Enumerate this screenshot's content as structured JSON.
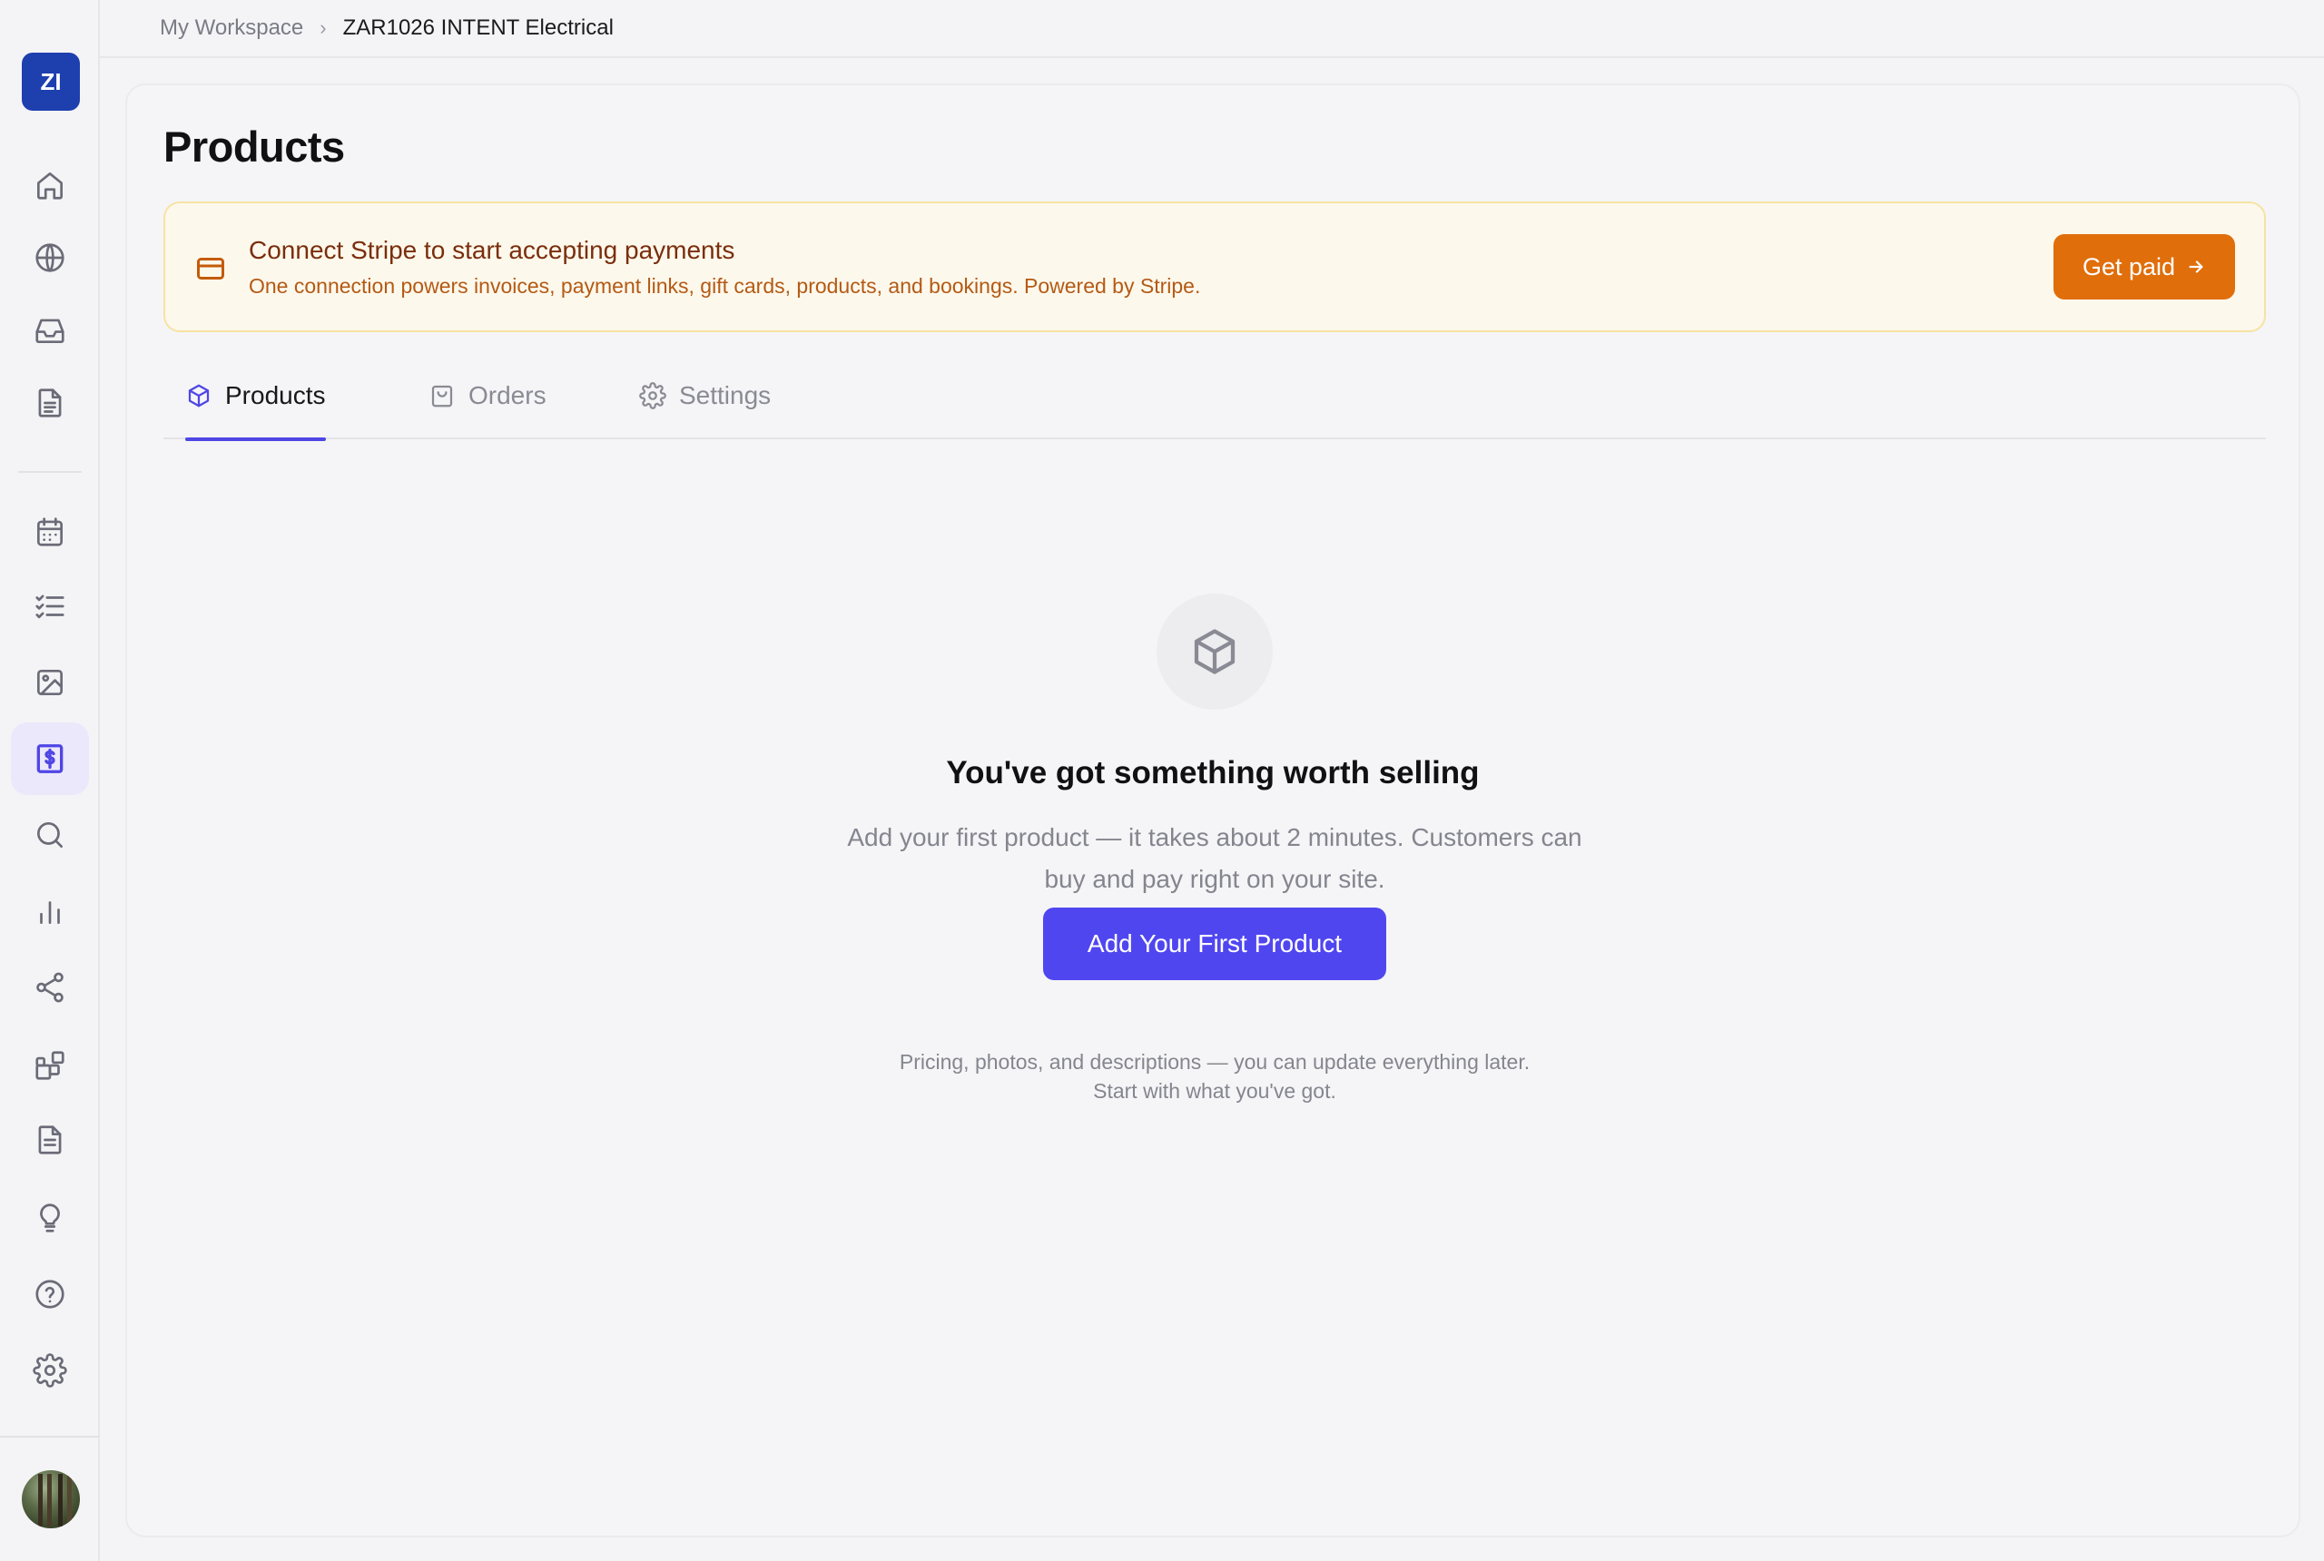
{
  "workspace": {
    "initials": "ZI"
  },
  "breadcrumb": {
    "items": [
      "My Workspace",
      "ZAR1026 INTENT Electrical"
    ],
    "separator": "›"
  },
  "sidebar": {
    "active": "payments",
    "items": [
      {
        "icon": "home-icon"
      },
      {
        "icon": "globe-icon"
      },
      {
        "icon": "inbox-icon"
      },
      {
        "icon": "document-icon"
      },
      {
        "icon": "calendar-icon"
      },
      {
        "icon": "checklist-icon"
      },
      {
        "icon": "image-icon"
      },
      {
        "icon": "receipt-dollar-icon"
      },
      {
        "icon": "search-icon"
      },
      {
        "icon": "bar-chart-icon"
      },
      {
        "icon": "share-icon"
      },
      {
        "icon": "widgets-icon"
      },
      {
        "icon": "file-text-icon"
      },
      {
        "icon": "lightbulb-icon"
      },
      {
        "icon": "help-circle-icon"
      },
      {
        "icon": "gear-icon"
      }
    ]
  },
  "page": {
    "title": "Products"
  },
  "banner": {
    "title": "Connect Stripe to start accepting payments",
    "subtitle": "One connection powers invoices, payment links, gift cards, products, and bookings. Powered by Stripe.",
    "button": "Get paid",
    "icon": "credit-card-icon"
  },
  "tabs": [
    {
      "label": "Products",
      "icon": "box-icon",
      "active": true
    },
    {
      "label": "Orders",
      "icon": "shopping-bag-icon",
      "active": false
    },
    {
      "label": "Settings",
      "icon": "gear-icon",
      "active": false
    }
  ],
  "empty_state": {
    "icon": "box-icon",
    "title": "You've got something worth selling",
    "description": "Add your first product — it takes about 2 minutes. Customers can buy and pay right on your site.",
    "button": "Add Your First Product",
    "note": "Pricing, photos, and descriptions — you can update everything later. Start with what you've got."
  },
  "colors": {
    "accent": "#4f46e5",
    "primary_button": "#5046f0",
    "warning_button": "#e06e0a",
    "workspace_badge": "#1e3fae",
    "banner_bg": "#fdf8ec"
  }
}
